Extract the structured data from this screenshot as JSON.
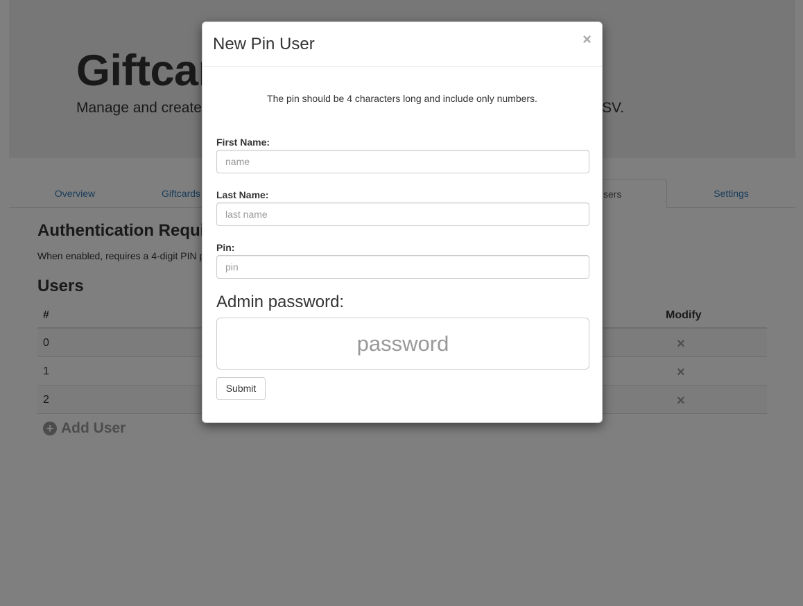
{
  "page": {
    "heading": "Giftcar",
    "lead": "Manage and create",
    "lead_end": "SV."
  },
  "tabs": [
    {
      "label": "Overview"
    },
    {
      "label": "Giftcards"
    },
    {
      "label": "sers"
    },
    {
      "label": "Settings"
    }
  ],
  "auth_section": {
    "title": "Authentication Requi",
    "description": "When enabled, requires a 4-digit PIN p"
  },
  "users": {
    "title": "Users",
    "columns": {
      "num": "#",
      "modify": "Modify"
    },
    "rows": [
      {
        "num": "0",
        "delete_glyph": "×"
      },
      {
        "num": "1",
        "delete_glyph": "×"
      },
      {
        "num": "2",
        "delete_glyph": "×"
      }
    ],
    "add_label": "Add User",
    "add_icon_glyph": "+"
  },
  "modal": {
    "title": "New Pin User",
    "close_glyph": "×",
    "hint": "The pin should be 4 characters long and include only numbers.",
    "first_name": {
      "label": "First Name:",
      "placeholder": "name",
      "value": ""
    },
    "last_name": {
      "label": "Last Name:",
      "placeholder": "last name",
      "value": ""
    },
    "pin": {
      "label": "Pin:",
      "placeholder": "pin",
      "value": ""
    },
    "admin_password": {
      "label": "Admin password:",
      "placeholder": "password",
      "value": ""
    },
    "submit_label": "Submit"
  },
  "colors": {
    "link": "#337ab7",
    "backdrop": "#000000"
  }
}
